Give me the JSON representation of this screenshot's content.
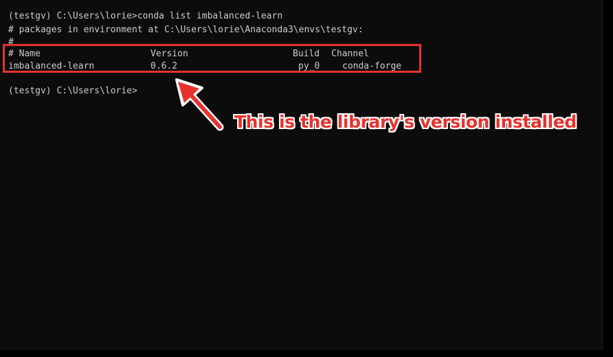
{
  "terminal": {
    "command_line": "(testgv) C:\\Users\\lorie>conda list imbalanced-learn",
    "env_info": "# packages in environment at C:\\Users\\lorie\\Anaconda3\\envs\\testgv:",
    "hash_line": "#",
    "table": {
      "headers": {
        "name": "# Name",
        "version": "Version",
        "build": "Build",
        "channel": "Channel"
      },
      "rows": [
        {
          "name": "imbalanced-learn",
          "version": "0.6.2",
          "build": "py_0",
          "channel": "conda-forge"
        }
      ]
    },
    "prompt": "(testgv) C:\\Users\\lorie>"
  },
  "annotation": {
    "text": "This is the library's version installed",
    "color": "#e8322e"
  },
  "colors": {
    "background": "#0c0c0c",
    "text": "#cccccc",
    "accent": "#e8322e"
  }
}
